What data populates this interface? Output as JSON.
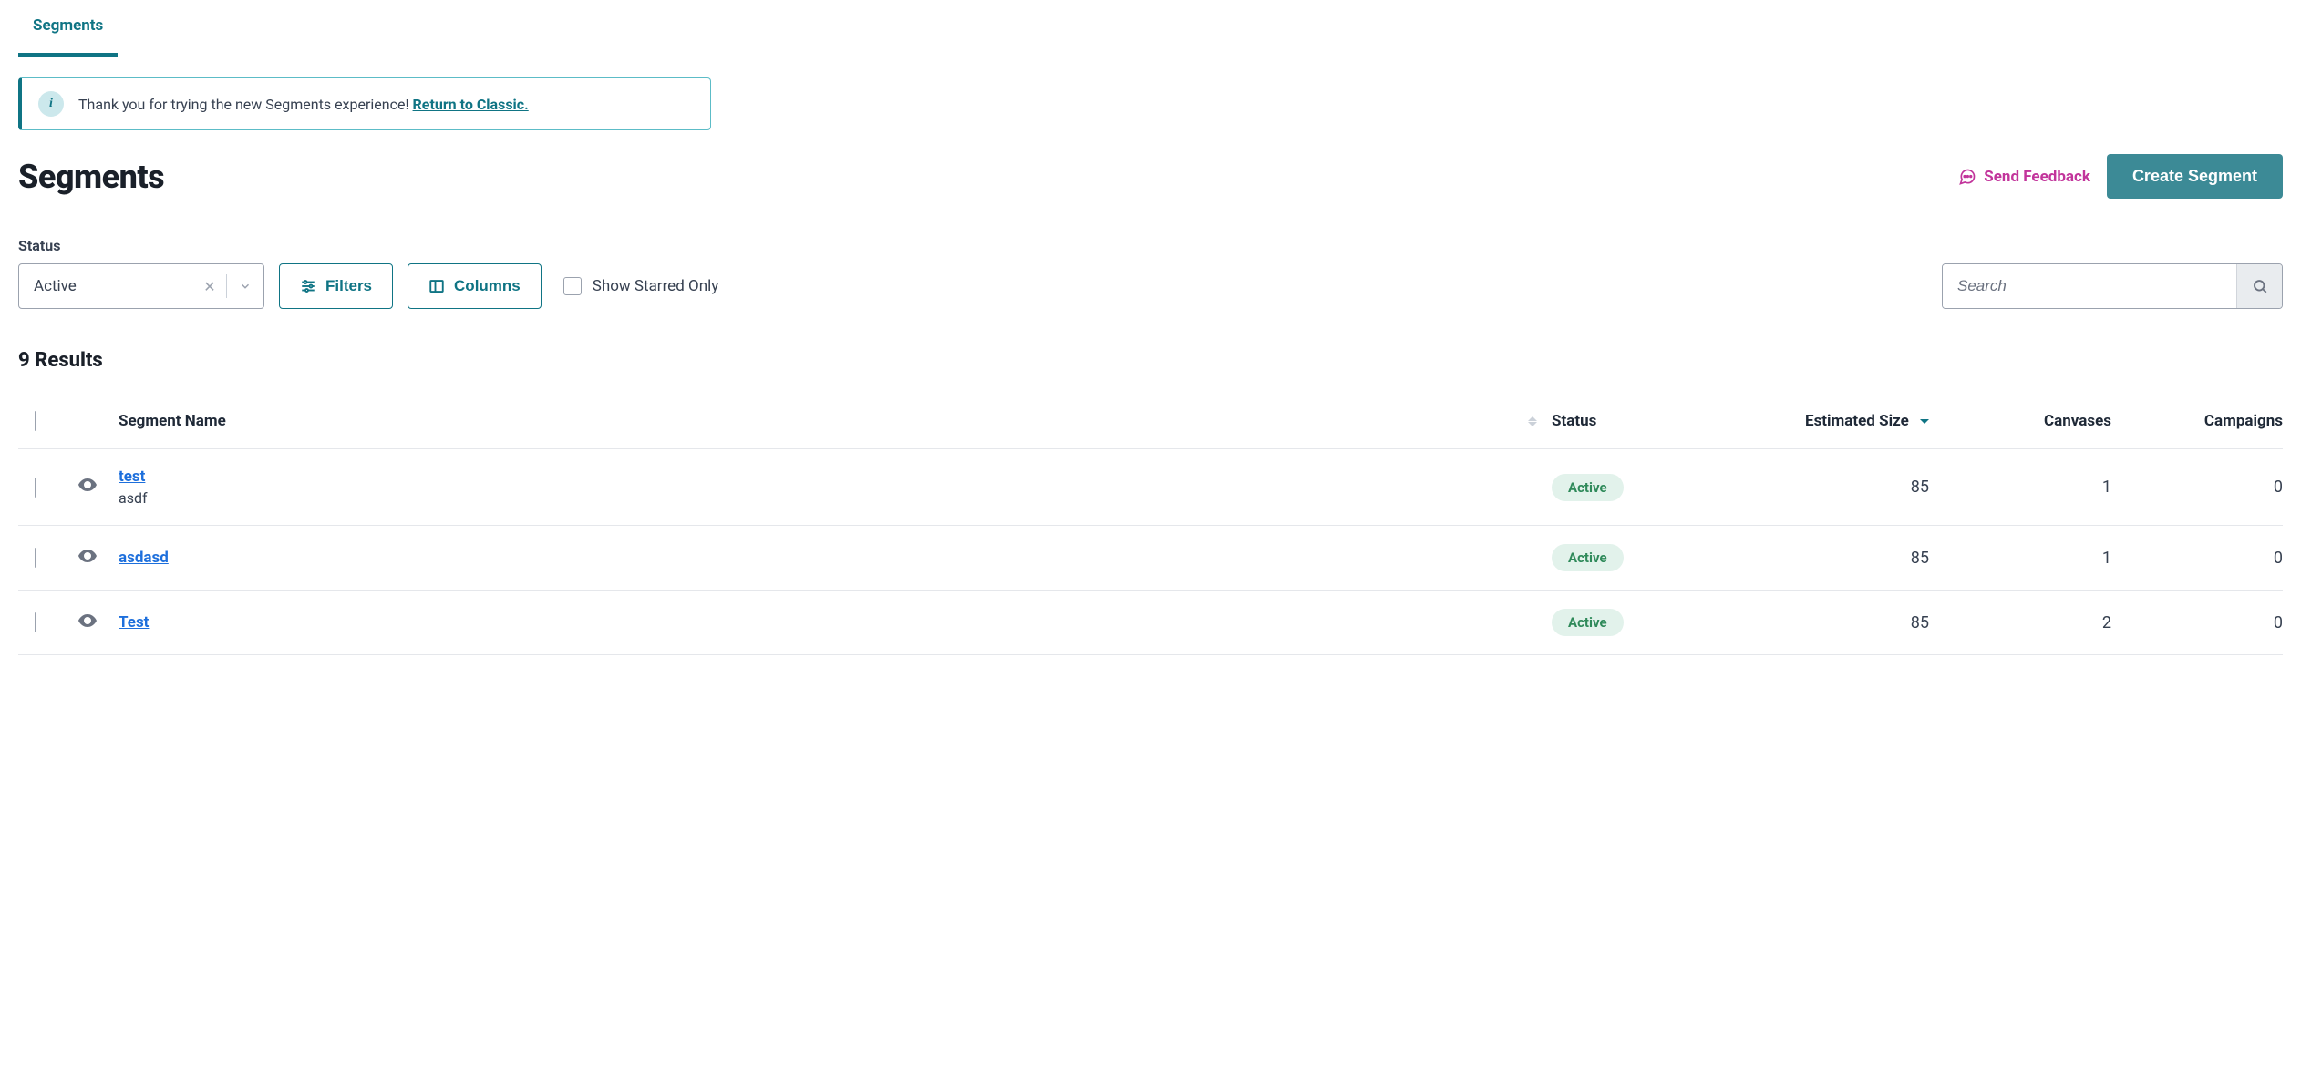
{
  "tabs": {
    "segments": "Segments"
  },
  "banner": {
    "message": "Thank you for trying the new Segments experience! ",
    "link": "Return to Classic."
  },
  "page_title": "Segments",
  "actions": {
    "feedback": "Send Feedback",
    "create": "Create Segment"
  },
  "filters": {
    "status_label": "Status",
    "status_value": "Active",
    "filters_btn": "Filters",
    "columns_btn": "Columns",
    "starred_only": "Show Starred Only",
    "search_placeholder": "Search"
  },
  "results_count": "9 Results",
  "table": {
    "headers": {
      "name": "Segment Name",
      "status": "Status",
      "size": "Estimated Size",
      "canvases": "Canvases",
      "campaigns": "Campaigns"
    },
    "rows": [
      {
        "name": "test",
        "sub": "asdf",
        "status": "Active",
        "size": "85",
        "canvases": "1",
        "campaigns": "0"
      },
      {
        "name": "asdasd",
        "sub": "",
        "status": "Active",
        "size": "85",
        "canvases": "1",
        "campaigns": "0"
      },
      {
        "name": "Test",
        "sub": "",
        "status": "Active",
        "size": "85",
        "canvases": "2",
        "campaigns": "0"
      }
    ]
  }
}
